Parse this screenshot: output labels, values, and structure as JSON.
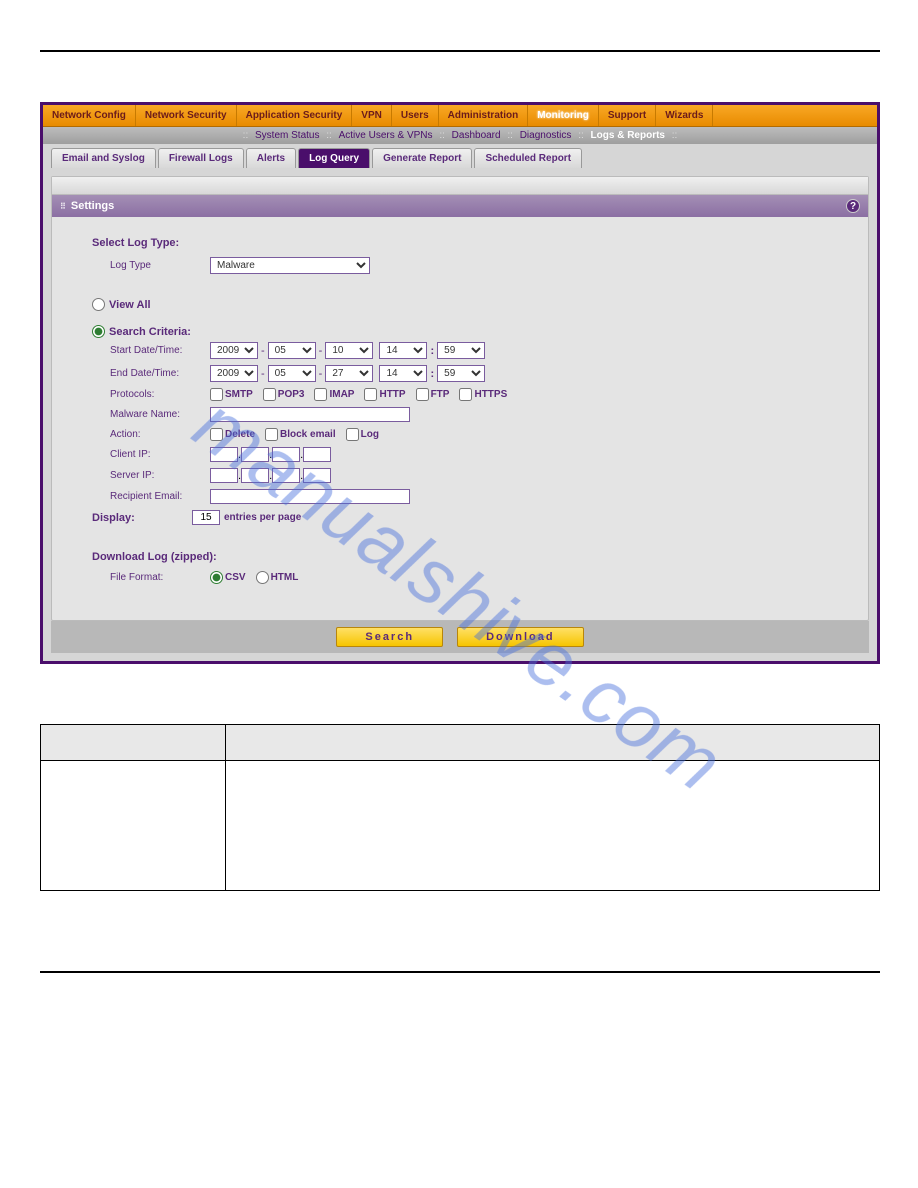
{
  "nav": {
    "items": [
      "Network Config",
      "Network Security",
      "Application Security",
      "VPN",
      "Users",
      "Administration",
      "Monitoring",
      "Support",
      "Wizards"
    ],
    "active": "Monitoring"
  },
  "subnav": {
    "items": [
      "System Status",
      "Active Users & VPNs",
      "Dashboard",
      "Diagnostics",
      "Logs & Reports"
    ],
    "active": "Logs & Reports"
  },
  "tabs": {
    "items": [
      "Email and Syslog",
      "Firewall Logs",
      "Alerts",
      "Log Query",
      "Generate Report",
      "Scheduled Report"
    ],
    "active": "Log Query"
  },
  "panel": {
    "title": "Settings"
  },
  "form": {
    "selectLogType": "Select Log Type:",
    "logTypeLabel": "Log Type",
    "logTypeValue": "Malware",
    "viewAll": "View All",
    "searchCriteria": "Search Criteria:",
    "startDateLabel": "Start Date/Time:",
    "endDateLabel": "End Date/Time:",
    "start": {
      "y": "2009",
      "m": "05",
      "d": "10",
      "h": "14",
      "min": "59"
    },
    "end": {
      "y": "2009",
      "m": "05",
      "d": "27",
      "h": "14",
      "min": "59"
    },
    "protocolsLabel": "Protocols:",
    "protocols": [
      "SMTP",
      "POP3",
      "IMAP",
      "HTTP",
      "FTP",
      "HTTPS"
    ],
    "malwareNameLabel": "Malware Name:",
    "actionLabel": "Action:",
    "actions": [
      "Delete",
      "Block email",
      "Log"
    ],
    "clientIpLabel": "Client IP:",
    "serverIpLabel": "Server IP:",
    "recipientEmailLabel": "Recipient Email:",
    "displayLabel": "Display:",
    "displayValue": "15",
    "displaySuffix": "entries per page",
    "downloadLabel": "Download Log (zipped):",
    "fileFormatLabel": "File Format:",
    "fileFormats": [
      "CSV",
      "HTML"
    ]
  },
  "buttons": {
    "search": "Search",
    "download": "Download"
  },
  "watermark": "manualshive.com"
}
